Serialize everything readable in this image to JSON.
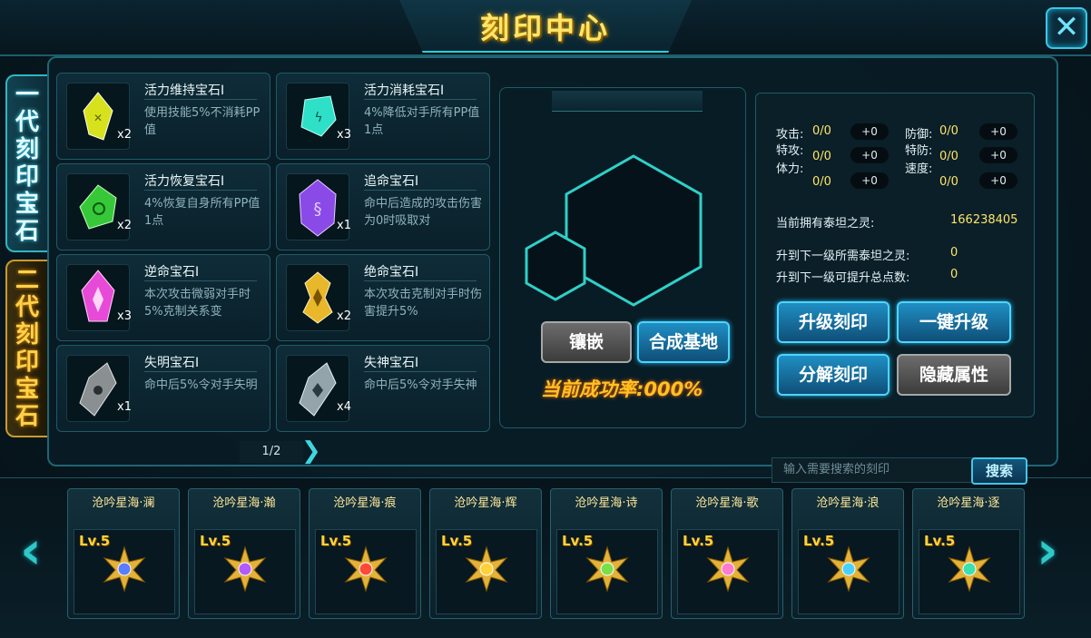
{
  "title": "刻印中心",
  "close_icon": "close-icon",
  "tabs": [
    {
      "label": "一代刻印宝石",
      "chars": [
        "一",
        "代",
        "刻",
        "印",
        "宝",
        "石"
      ]
    },
    {
      "label": "二代刻印宝石",
      "chars": [
        "二",
        "代",
        "刻",
        "印",
        "宝",
        "石"
      ]
    }
  ],
  "gems": [
    {
      "name": "活力维持宝石I",
      "desc": "使用技能5%不消耗PP值",
      "count": "x2",
      "color": "#d8e21c"
    },
    {
      "name": "活力消耗宝石I",
      "desc": "4%降低对手所有PP值1点",
      "count": "x3",
      "color": "#2fe0c8"
    },
    {
      "name": "活力恢复宝石I",
      "desc": "4%恢复自身所有PP值1点",
      "count": "x2",
      "color": "#37c83a"
    },
    {
      "name": "追命宝石I",
      "desc": "命中后造成的攻击伤害为0时吸取对",
      "count": "x1",
      "color": "#8a4ae8"
    },
    {
      "name": "逆命宝石I",
      "desc": "本次攻击微弱对手时5%克制关系变",
      "count": "x3",
      "color": "#e84ad8"
    },
    {
      "name": "绝命宝石I",
      "desc": "本次攻击克制对手时伤害提升5%",
      "count": "x2",
      "color": "#e8b82a"
    },
    {
      "name": "失明宝石I",
      "desc": "命中后5%令对手失明",
      "count": "x1",
      "color": "#8a8f92"
    },
    {
      "name": "失神宝石I",
      "desc": "命中后5%令对手失神",
      "count": "x4",
      "color": "#93a4aa"
    }
  ],
  "pager": {
    "text": "1/2"
  },
  "center": {
    "inlay_button": "镶嵌",
    "synth_button": "合成基地",
    "rate_label": "当前成功率:",
    "rate_value": "000%"
  },
  "stats": {
    "attack_label": "攻击:",
    "attack_value": "0/0",
    "attack_plus": "+0",
    "defense_label": "防御:",
    "defense_value": "0/0",
    "defense_plus": "+0",
    "spattack_label": "特攻:",
    "spattack_value": "0/0",
    "spattack_plus": "+0",
    "spdefense_label": "特防:",
    "spdefense_value": "0/0",
    "spdefense_plus": "+0",
    "hp_label": "体力:",
    "hp_value": "0/0",
    "hp_plus": "+0",
    "speed_label": "速度:",
    "speed_value": "0/0",
    "speed_plus": "+0",
    "owned_label": "当前拥有泰坦之灵:",
    "owned_value": "166238405",
    "need_label": "升到下一级所需泰坦之灵:",
    "need_value": "0",
    "total_label": "升到下一级可提升总点数:",
    "total_value": "0"
  },
  "actions": {
    "upgrade": "升级刻印",
    "oneclick": "一键升级",
    "decompose": "分解刻印",
    "hide": "隐藏属性"
  },
  "search": {
    "placeholder": "输入需要搜索的刻印",
    "button": "搜索"
  },
  "marks": [
    {
      "name": "沧吟星海·澜",
      "level": "Lv.5",
      "color": "#5a7cff"
    },
    {
      "name": "沧吟星海·瀚",
      "level": "Lv.5",
      "color": "#b05aff"
    },
    {
      "name": "沧吟星海·痕",
      "level": "Lv.5",
      "color": "#ff4a3a"
    },
    {
      "name": "沧吟星海·辉",
      "level": "Lv.5",
      "color": "#ffd23a"
    },
    {
      "name": "沧吟星海·诗",
      "level": "Lv.5",
      "color": "#7ae04a"
    },
    {
      "name": "沧吟星海·歌",
      "level": "Lv.5",
      "color": "#ff7ad0"
    },
    {
      "name": "沧吟星海·浪",
      "level": "Lv.5",
      "color": "#4ad0ff"
    },
    {
      "name": "沧吟星海·逐",
      "level": "Lv.5",
      "color": "#3ae0b0"
    }
  ],
  "arrows": {
    "left": "‹",
    "right": "›"
  }
}
